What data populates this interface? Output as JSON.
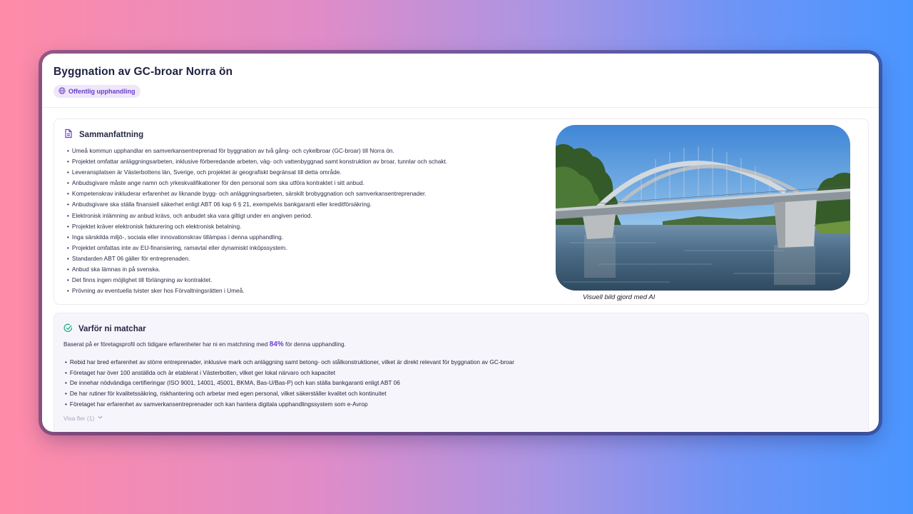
{
  "project": {
    "title": "Byggnation av GC-broar Norra ön",
    "badge": "Offentlig upphandling"
  },
  "summary": {
    "heading": "Sammanfattning",
    "items": [
      "Umeå kommun upphandlar en samverkansentreprenad för byggnation av två gång- och cykelbroar (GC-broar) till Norra ön.",
      "Projektet omfattar anläggningsarbeten, inklusive förberedande arbeten, väg- och vattenbyggnad samt konstruktion av broar, tunnlar och schakt.",
      "Leveransplatsen är Västerbottens län, Sverige, och projektet är geografiskt begränsat till detta område.",
      "Anbudsgivare måste ange namn och yrkeskvalifikationer för den personal som ska utföra kontraktet i sitt anbud.",
      "Kompetenskrav inkluderar erfarenhet av liknande bygg- och anläggningsarbeten, särskilt brobyggnation och samverkansentreprenader.",
      "Anbudsgivare ska ställa finansiell säkerhet enligt ABT 06 kap 6 § 21, exempelvis bankgaranti eller kreditförsäkring.",
      "Elektronisk inlämning av anbud krävs, och anbudet ska vara giltigt under en angiven period.",
      "Projektet kräver elektronisk fakturering och elektronisk betalning.",
      "Inga särskilda miljö-, sociala eller innovationskrav tillämpas i denna upphandling.",
      "Projektet omfattas inte av EU-finansiering, ramavtal eller dynamiskt inköpssystem.",
      "Standarden ABT 06 gäller för entreprenaden.",
      "Anbud ska lämnas in på svenska.",
      "Det finns ingen möjlighet till förlängning av kontraktet.",
      "Prövning av eventuella tvister sker hos Förvaltningsrätten i Umeå."
    ],
    "image_caption": "Visuell bild gjord med AI"
  },
  "match": {
    "heading": "Varför ni matchar",
    "intro_before": "Baserat på er företagsprofil och tidigare erfarenheter har ni en matchning med",
    "percent": "84%",
    "intro_after": "för denna upphandling.",
    "items": [
      "Rebid har bred erfarenhet av större entreprenader, inklusive mark och anläggning samt betong- och stålkonstruktioner, vilket är direkt relevant för byggnation av GC-broar",
      "Företaget har över 100 anställda och är etablerat i Västerbotten, vilket ger lokal närvaro och kapacitet",
      "De innehar nödvändiga certifieringar (ISO 9001, 14001, 45001, BKMA, Bas-U/Bas-P) och kan ställa bankgaranti enligt ABT 06",
      "De har rutiner för kvalitetssäkring, riskhantering och arbetar med egen personal, vilket säkerställer kvalitet och kontinuitet",
      "Företaget har erfarenhet av samverkansentreprenader och kan hantera digitala upphandlingssystem som e-Avrop"
    ],
    "show_more": "Visa fler (1)"
  },
  "icons": {
    "badge": "globe-icon",
    "summary": "document-icon",
    "match": "check-circle-icon",
    "show_more": "chevron-down-icon"
  },
  "colors": {
    "accent": "#6b3fd0",
    "badge_bg": "#efe6fb",
    "match_icon": "#22b07d"
  }
}
